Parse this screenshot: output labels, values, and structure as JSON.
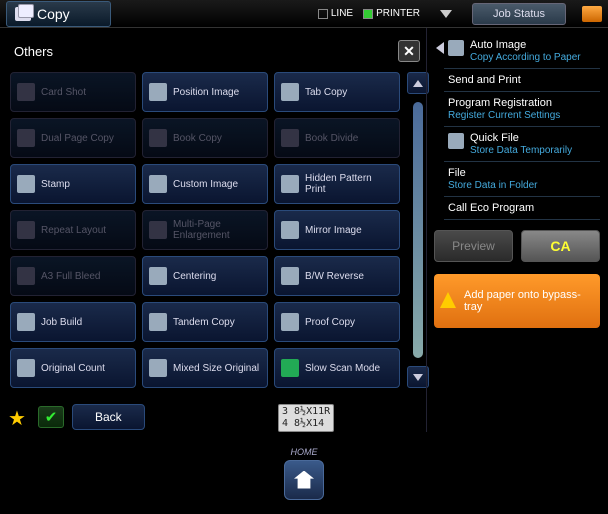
{
  "top": {
    "mode": "Copy",
    "ind_line": "LINE",
    "ind_printer": "PRINTER",
    "job_status": "Job Status"
  },
  "panel": {
    "title": "Others"
  },
  "options": [
    {
      "label": "Card Shot",
      "dim": true
    },
    {
      "label": "Position Image",
      "dim": false
    },
    {
      "label": "Tab Copy",
      "dim": false
    },
    {
      "label": "Dual Page Copy",
      "dim": true
    },
    {
      "label": "Book Copy",
      "dim": true
    },
    {
      "label": "Book Divide",
      "dim": true
    },
    {
      "label": "Stamp",
      "dim": false
    },
    {
      "label": "Custom Image",
      "dim": false
    },
    {
      "label": "Hidden Pattern Print",
      "dim": false
    },
    {
      "label": "Repeat Layout",
      "dim": true
    },
    {
      "label": "Multi-Page Enlargement",
      "dim": true
    },
    {
      "label": "Mirror Image",
      "dim": false
    },
    {
      "label": "A3 Full Bleed",
      "dim": true
    },
    {
      "label": "Centering",
      "dim": false
    },
    {
      "label": "B/W Reverse",
      "dim": false
    },
    {
      "label": "Job Build",
      "dim": false
    },
    {
      "label": "Tandem Copy",
      "dim": false
    },
    {
      "label": "Proof Copy",
      "dim": false
    },
    {
      "label": "Original Count",
      "dim": false
    },
    {
      "label": "Mixed Size Original",
      "dim": false
    },
    {
      "label": "Slow Scan Mode",
      "dim": false,
      "checked": true
    }
  ],
  "right": [
    {
      "title": "Auto Image",
      "sub": "Copy According to Paper",
      "icon": true
    },
    {
      "title": "Send and Print",
      "sub": "",
      "icon": false
    },
    {
      "title": "Program Registration",
      "sub": "Register Current Settings",
      "icon": false
    },
    {
      "title": "Quick File",
      "sub": "Store Data Temporarily",
      "icon": true
    },
    {
      "title": "File",
      "sub": "Store Data in Folder",
      "icon": false
    },
    {
      "title": "Call Eco Program",
      "sub": "",
      "icon": false
    }
  ],
  "actions": {
    "preview": "Preview",
    "ca": "CA"
  },
  "warning": "Add paper onto bypass-tray",
  "back": "Back",
  "tray": {
    "l1": "3 8½X11R",
    "l2": "4 8½X14"
  },
  "home": "HOME"
}
